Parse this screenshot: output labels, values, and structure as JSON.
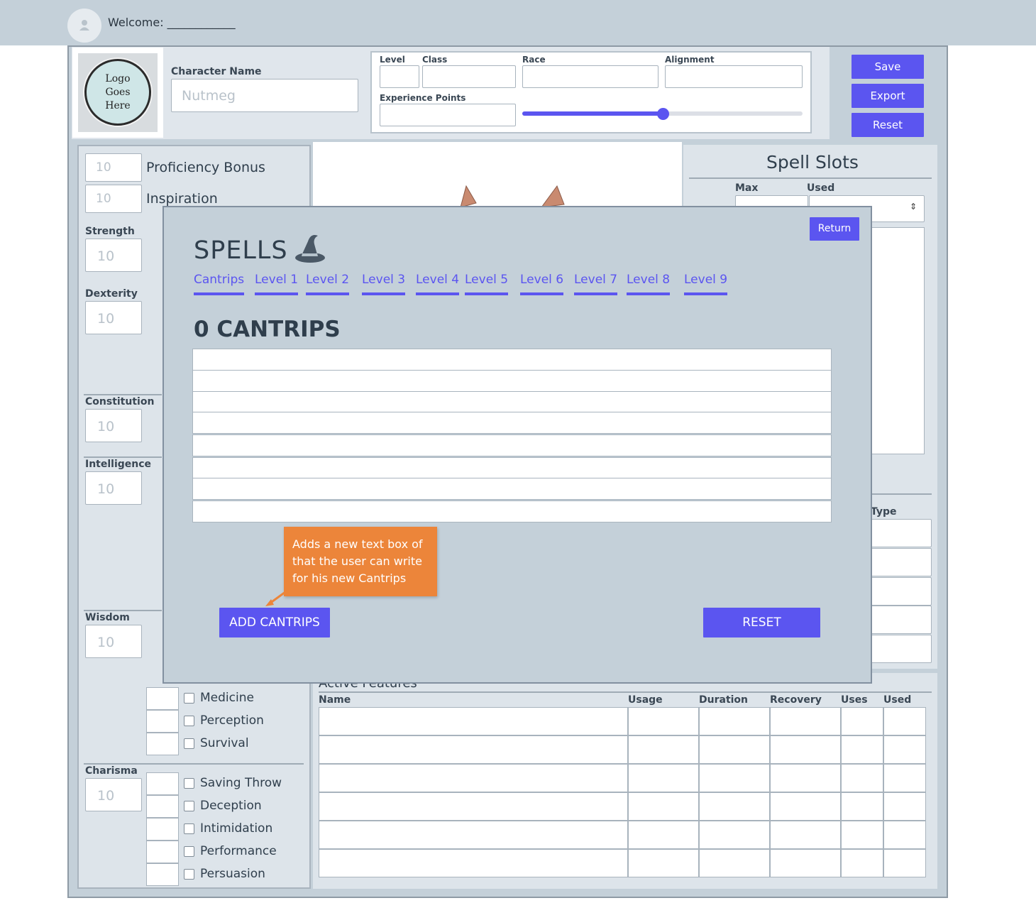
{
  "topbar": {
    "welcome": "Welcome: ____________"
  },
  "logo": {
    "text": "Logo\nGoes\nHere"
  },
  "character": {
    "name_label": "Character Name",
    "name_placeholder": "Nutmeg"
  },
  "info": {
    "level_label": "Level",
    "class_label": "Class",
    "race_label": "Race",
    "alignment_label": "Alignment",
    "xp_label": "Experience Points",
    "xp_slider_fraction": 0.5
  },
  "actions": {
    "save": "Save",
    "export": "Export",
    "reset": "Reset"
  },
  "left": {
    "proficiency_value": "10",
    "proficiency_label": "Proficiency Bonus",
    "inspiration_value": "10",
    "inspiration_label": "Inspiration",
    "stats": [
      {
        "label": "Strength",
        "value": "10"
      },
      {
        "label": "Dexterity",
        "value": "10"
      },
      {
        "label": "Constitution",
        "value": "10"
      },
      {
        "label": "Intelligence",
        "value": "10"
      },
      {
        "label": "Wisdom",
        "value": "10"
      },
      {
        "label": "Charisma",
        "value": "10"
      }
    ],
    "wisdom_skills": [
      "Medicine",
      "Perception",
      "Survival"
    ],
    "charisma_skills": [
      "Saving Throw",
      "Deception",
      "Intimidation",
      "Performance",
      "Persuasion"
    ]
  },
  "spell_slots": {
    "title": "Spell Slots",
    "max_label": "Max",
    "used_label": "Used",
    "type_label": "Type"
  },
  "features": {
    "title": "Active Features",
    "columns": [
      "Name",
      "Usage",
      "Duration",
      "Recovery",
      "Uses",
      "Used"
    ]
  },
  "modal": {
    "title": "SPELLS",
    "return_label": "Return",
    "tabs": [
      "Cantrips",
      "Level 1",
      "Level 2",
      "Level 3",
      "Level 4",
      "Level 5",
      "Level 6",
      "Level 7",
      "Level 8",
      "Level 9"
    ],
    "heading": "0 CANTRIPS",
    "add_label": "ADD CANTRIPS",
    "reset_label": "RESET",
    "callout": "Adds a new text box of that the user can write for his new Cantrips"
  },
  "colors": {
    "accent": "#5b55f0",
    "callout": "#ec853a",
    "panel": "#c4d0d9"
  }
}
